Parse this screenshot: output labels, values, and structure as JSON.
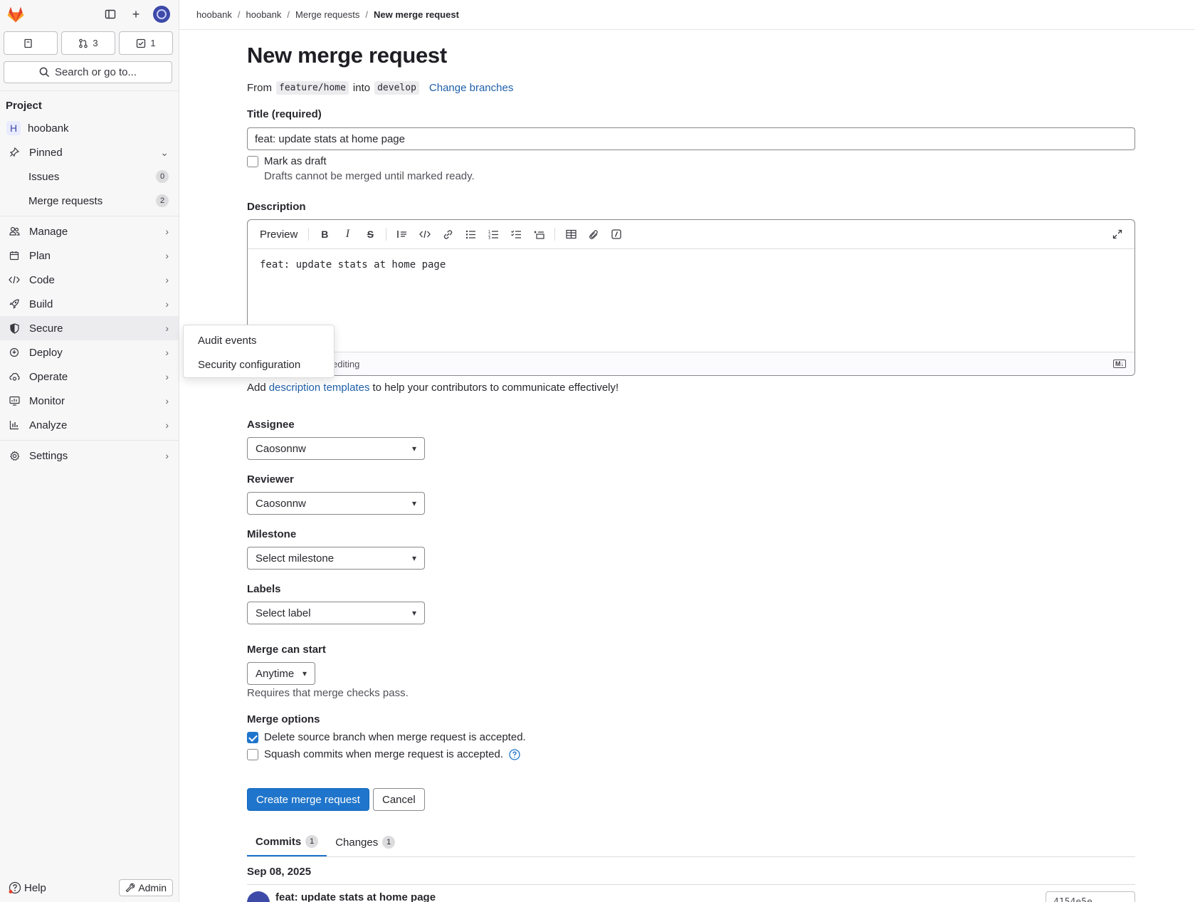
{
  "breadcrumb": [
    "hoobank",
    "hoobank",
    "Merge requests",
    "New merge request"
  ],
  "counters": {
    "issues": "",
    "merge_requests": "3",
    "todos": "1"
  },
  "search": {
    "label": "Search or go to..."
  },
  "sidebar": {
    "section": "Project",
    "project": {
      "initial": "H",
      "name": "hoobank"
    },
    "pinned": {
      "label": "Pinned",
      "items": [
        {
          "label": "Issues",
          "count": "0"
        },
        {
          "label": "Merge requests",
          "count": "2"
        }
      ]
    },
    "items": [
      {
        "label": "Manage"
      },
      {
        "label": "Plan"
      },
      {
        "label": "Code"
      },
      {
        "label": "Build"
      },
      {
        "label": "Secure"
      },
      {
        "label": "Deploy"
      },
      {
        "label": "Operate"
      },
      {
        "label": "Monitor"
      },
      {
        "label": "Analyze"
      },
      {
        "label": "Settings"
      }
    ],
    "help": "Help",
    "admin": "Admin"
  },
  "flyout": {
    "items": [
      "Audit events",
      "Security configuration"
    ]
  },
  "page": {
    "title": "New merge request",
    "from_label": "From",
    "source_branch": "feature/home",
    "into_label": "into",
    "target_branch": "develop",
    "change_branches": "Change branches"
  },
  "form": {
    "title_label": "Title (required)",
    "title_value": "feat: update stats at home page",
    "draft_label": "Mark as draft",
    "draft_help": "Drafts cannot be merged until marked ready.",
    "description_label": "Description",
    "preview": "Preview",
    "description_value": "feat: update stats at home page",
    "editor_footer": "editing",
    "templates_pre": "Add",
    "templates_link": "description templates",
    "templates_post": "to help your contributors to communicate effectively!",
    "assignee_label": "Assignee",
    "assignee_value": "Caosonnw",
    "reviewer_label": "Reviewer",
    "reviewer_value": "Caosonnw",
    "milestone_label": "Milestone",
    "milestone_value": "Select milestone",
    "labels_label": "Labels",
    "labels_value": "Select label",
    "merge_start_label": "Merge can start",
    "merge_start_value": "Anytime",
    "merge_start_help": "Requires that merge checks pass.",
    "merge_options_label": "Merge options",
    "delete_branch": "Delete source branch when merge request is accepted.",
    "squash": "Squash commits when merge request is accepted.",
    "create": "Create merge request",
    "cancel": "Cancel"
  },
  "tabs": [
    {
      "label": "Commits",
      "count": "1"
    },
    {
      "label": "Changes",
      "count": "1"
    }
  ],
  "commits": {
    "date": "Sep 08, 2025",
    "title": "feat: update stats at home page",
    "sha": "4154e5e"
  },
  "colors": {
    "primary": "#1f75cb",
    "link": "#1f5fa8",
    "logo": "#e24329"
  }
}
